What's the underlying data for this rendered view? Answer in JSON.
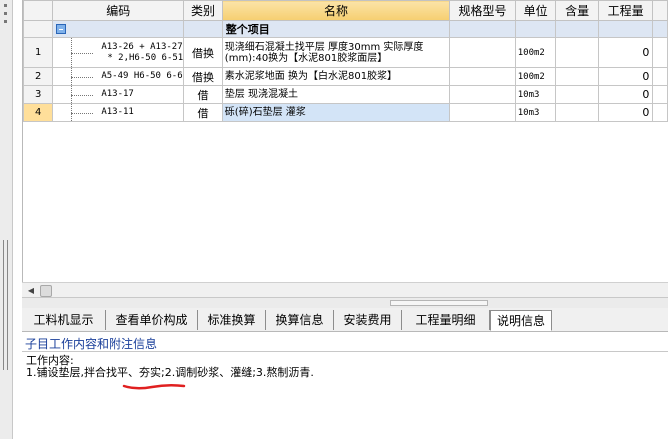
{
  "table": {
    "headers": [
      "编码",
      "类别",
      "名称",
      "规格型号",
      "单位",
      "含量",
      "工程量"
    ],
    "group": {
      "title": "整个项目"
    },
    "rows": [
      {
        "num": "1",
        "code1": "A13-26 + A13-27",
        "code2": "* 2,H6-50 6-51",
        "type": "借换",
        "name": "现浇细石混凝土找平层 厚度30mm 实际厚度(mm):40换为【水泥801胶浆面层】",
        "unit": "100m2",
        "qty": "0"
      },
      {
        "num": "2",
        "code1": "A5-49 H6-50 6-6",
        "type": "借换",
        "name": "素水泥浆地面 换为【白水泥801胶浆】",
        "unit": "100m2",
        "qty": "0"
      },
      {
        "num": "3",
        "code1": "A13-17",
        "type": "借",
        "name": "垫层 现浇混凝土",
        "unit": "10m3",
        "qty": "0"
      },
      {
        "num": "4",
        "code1": "A13-11",
        "type": "借",
        "name": "砾(碎)石垫层 灌浆",
        "unit": "10m3",
        "qty": "0"
      }
    ]
  },
  "tabs": [
    {
      "label": "工料机显示"
    },
    {
      "label": "查看单价构成"
    },
    {
      "label": "标准换算"
    },
    {
      "label": "换算信息"
    },
    {
      "label": "安装费用"
    },
    {
      "label": "工程量明细"
    },
    {
      "label": "说明信息"
    }
  ],
  "panel": {
    "title": "子目工作内容和附注信息",
    "heading": "工作内容:",
    "line": "1.铺设垫层,拌合找平、夯实;2.调制砂浆、灌缝;3.熬制沥青."
  },
  "colors": {
    "header_highlight": "#f6cf70",
    "selected_row": "#d3e4f7",
    "panel_title": "#1a3f9a",
    "squiggle": "#e02020"
  }
}
